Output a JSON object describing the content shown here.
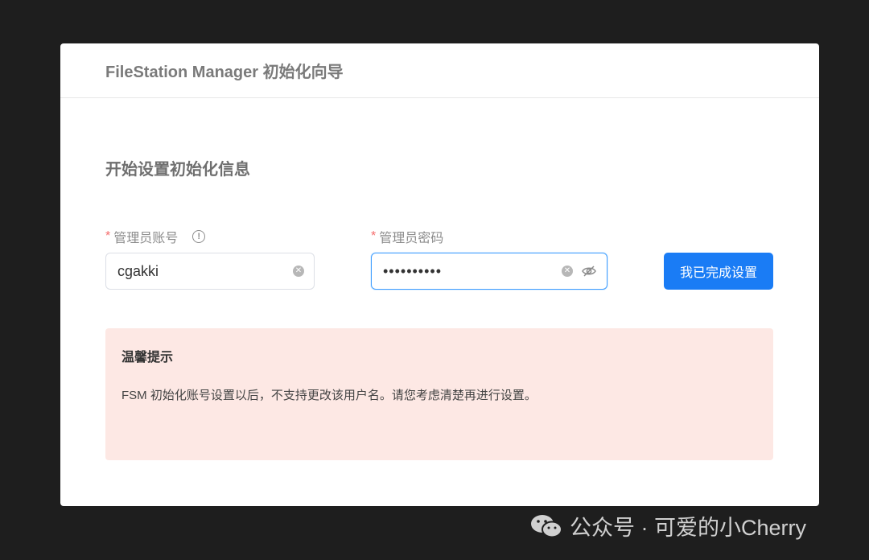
{
  "dialog": {
    "title": "FileStation Manager 初始化向导"
  },
  "form": {
    "section_title": "开始设置初始化信息",
    "required_mark": "*",
    "account": {
      "label": "管理员账号",
      "value": "cgakki",
      "info_icon": "info-circle-icon",
      "clear_icon": "clear-circle-icon"
    },
    "password": {
      "label": "管理员密码",
      "value": "••••••••••",
      "clear_icon": "clear-circle-icon",
      "visibility_icon": "eye-off-icon"
    },
    "submit_label": "我已完成设置"
  },
  "alert": {
    "title": "温馨提示",
    "message": "FSM 初始化账号设置以后，不支持更改该用户名。请您考虑清楚再进行设置。"
  },
  "watermark": {
    "icon": "wechat-icon",
    "text": "公众号 · 可爱的小Cherry"
  },
  "colors": {
    "background": "#1e1e1e",
    "primary": "#1a7cf5",
    "required": "#f56c6c",
    "alert_bg": "#fde8e4",
    "focus_border": "#409eff"
  }
}
